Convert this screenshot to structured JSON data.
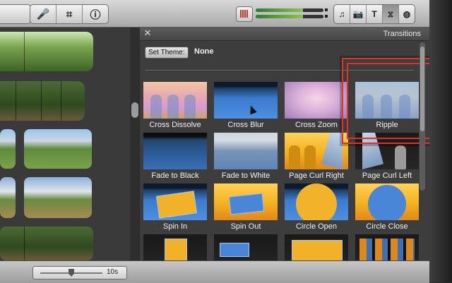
{
  "toolbar": {
    "left_group": [
      {
        "name": "mic-icon",
        "glyph": "🎤"
      },
      {
        "name": "crop-icon",
        "glyph": "⌗"
      },
      {
        "name": "info-icon",
        "glyph": "ⓘ"
      }
    ],
    "right_group": [
      {
        "name": "music-icon",
        "glyph": "♫"
      },
      {
        "name": "camera-icon",
        "glyph": "📷"
      },
      {
        "name": "title-icon",
        "glyph": "T"
      },
      {
        "name": "transitions-icon",
        "glyph": "⧖"
      },
      {
        "name": "globe-icon",
        "glyph": "◍"
      }
    ],
    "active_right_index": 3
  },
  "transitions": {
    "title": "Transitions",
    "close_glyph": "✕",
    "set_theme_label": "Set Theme:",
    "theme_value": "None",
    "items": [
      {
        "label": "Cross Dissolve"
      },
      {
        "label": "Cross Blur"
      },
      {
        "label": "Cross Zoom"
      },
      {
        "label": "Ripple"
      },
      {
        "label": "Fade to Black"
      },
      {
        "label": "Fade to White"
      },
      {
        "label": "Page Curl Right"
      },
      {
        "label": "Page Curl Left"
      },
      {
        "label": "Spin In"
      },
      {
        "label": "Spin Out"
      },
      {
        "label": "Circle Open"
      },
      {
        "label": "Circle Close"
      }
    ],
    "highlighted": "Ripple"
  },
  "bottom": {
    "zoom_label": "10s"
  },
  "colors": {
    "highlight": "#e0302a",
    "panel": "#3d3d3d"
  }
}
